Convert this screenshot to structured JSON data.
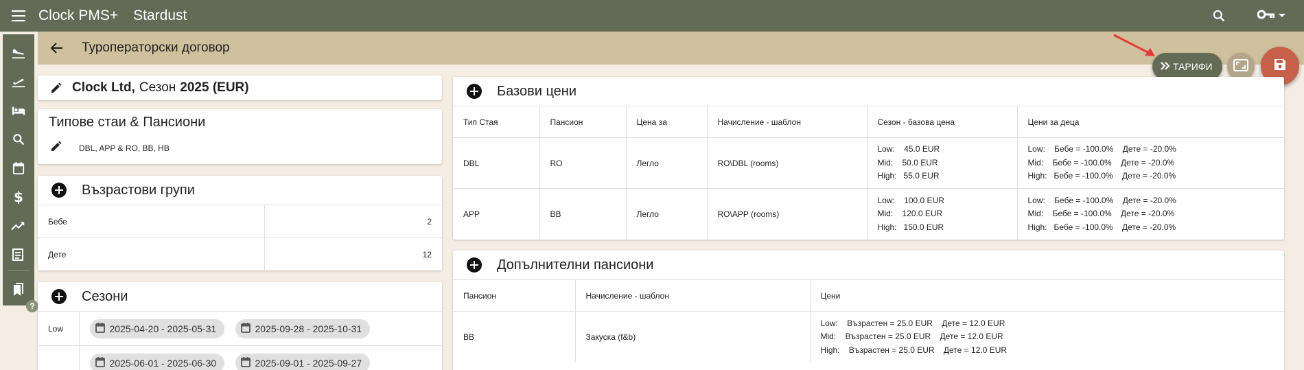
{
  "topbar": {
    "app_title": "Clock PMS+",
    "hotel_name": "Stardust"
  },
  "page": {
    "title": "Туроператорски договор"
  },
  "actions": {
    "tariffs_label": "ТАРИФИ"
  },
  "contract": {
    "company": "Clock Ltd,",
    "season_prefix": "Сезон",
    "season_year": "2025 (EUR)"
  },
  "room_types": {
    "title": "Типове стаи & Пансиони",
    "value": "DBL, APP & RO, BB, HB"
  },
  "age_groups": {
    "title": "Възрастови групи",
    "rows": [
      {
        "name": "Бебе",
        "value": "2"
      },
      {
        "name": "Дете",
        "value": "12"
      }
    ]
  },
  "seasons": {
    "title": "Сезони",
    "rows": [
      {
        "name": "Low",
        "ranges": [
          "2025-04-20 - 2025-05-31",
          "2025-09-28 - 2025-10-31"
        ]
      },
      {
        "name": "",
        "ranges": [
          "2025-06-01 - 2025-06-30",
          "2025-09-01 - 2025-09-27"
        ]
      }
    ]
  },
  "base_prices": {
    "title": "Базови цени",
    "headers": [
      "Тип Стая",
      "Пансион",
      "Цена за",
      "Начисление - шаблон",
      "Сезон - базова цена",
      "Цени за деца"
    ],
    "rows": [
      {
        "room": "DBL",
        "board": "RO",
        "price_for": "Легло",
        "template": "RO\\DBL (rooms)",
        "season_prices": [
          "Low:    45.0 EUR",
          "Mid:    50.0 EUR",
          "High:   55.0 EUR"
        ],
        "child_prices": [
          "Low:    Бебе = -100.0%    Дете = -20.0%",
          "Mid:    Бебе = -100.0%    Дете = -20.0%",
          "High:   Бебе = -100.0%    Дете = -20.0%"
        ]
      },
      {
        "room": "APP",
        "board": "BB",
        "price_for": "Легло",
        "template": "RO\\APP (rooms)",
        "season_prices": [
          "Low:    100.0 EUR",
          "Mid:    120.0 EUR",
          "High:   150.0 EUR"
        ],
        "child_prices": [
          "Low:    Бебе = -100.0%    Дете = -20.0%",
          "Mid:    Бебе = -100.0%    Дете = -20.0%",
          "High:   Бебе = -100.0%    Дете = -20.0%"
        ]
      }
    ]
  },
  "extra_boards": {
    "title": "Допълнителни пансиони",
    "headers": [
      "Пансион",
      "Начисление - шаблон",
      "Цени"
    ],
    "rows": [
      {
        "board": "BB",
        "template": "Закуска (f&b)",
        "prices": [
          "Low:    Възрастен = 25.0 EUR    Дете = 12.0 EUR",
          "Mid:    Възрастен = 25.0 EUR    Дете = 12.0 EUR",
          "High:    Възрастен = 25.0 EUR    Дете = 12.0 EUR"
        ]
      }
    ]
  },
  "icons": {
    "rail": [
      "airplane-landing-icon",
      "airplane-takeoff-icon",
      "bed-icon",
      "search-icon",
      "calendar-icon",
      "dollar-icon",
      "trending-up-icon",
      "receipt-icon",
      "bookmarks-icon"
    ]
  }
}
